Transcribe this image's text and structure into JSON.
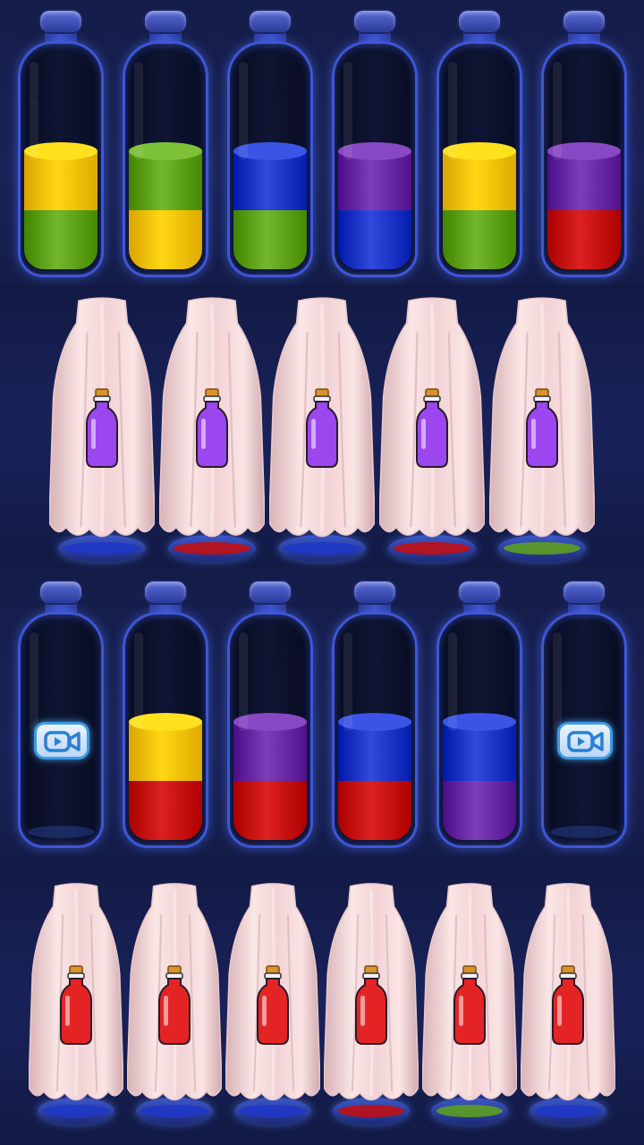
{
  "game": {
    "colors": {
      "yellow": "#f7c300",
      "green": "#5fa31a",
      "blue": "#1e36c8",
      "purple": "#6a2aa6",
      "red": "#c80d0d",
      "cloth": "#f4d6d6",
      "icon_purple": "#9b46ee",
      "icon_red": "#e42424",
      "glass_rim": "#3e56d8",
      "background": "#141c48"
    },
    "row1_bottles": [
      {
        "layers_bottom_to_top": [
          "green",
          "yellow"
        ]
      },
      {
        "layers_bottom_to_top": [
          "yellow",
          "green"
        ]
      },
      {
        "layers_bottom_to_top": [
          "green",
          "blue"
        ]
      },
      {
        "layers_bottom_to_top": [
          "blue",
          "purple"
        ]
      },
      {
        "layers_bottom_to_top": [
          "green",
          "yellow"
        ]
      },
      {
        "layers_bottom_to_top": [
          "red",
          "purple"
        ]
      }
    ],
    "row2_veiled": [
      {
        "hint_icon": "purple-potion-icon",
        "peek_color": "blue"
      },
      {
        "hint_icon": "purple-potion-icon",
        "peek_color": "red"
      },
      {
        "hint_icon": "purple-potion-icon",
        "peek_color": "blue"
      },
      {
        "hint_icon": "purple-potion-icon",
        "peek_color": "red"
      },
      {
        "hint_icon": "purple-potion-icon",
        "peek_color": "green"
      }
    ],
    "row3_bottles": [
      {
        "layers_bottom_to_top": [],
        "locked": true,
        "unlock_icon": "video-ad-icon"
      },
      {
        "layers_bottom_to_top": [
          "red",
          "yellow"
        ]
      },
      {
        "layers_bottom_to_top": [
          "red",
          "purple"
        ]
      },
      {
        "layers_bottom_to_top": [
          "red",
          "blue"
        ]
      },
      {
        "layers_bottom_to_top": [
          "purple",
          "blue"
        ]
      },
      {
        "layers_bottom_to_top": [],
        "locked": true,
        "unlock_icon": "video-ad-icon"
      }
    ],
    "row4_veiled": [
      {
        "hint_icon": "red-potion-icon",
        "peek_color": "blue"
      },
      {
        "hint_icon": "red-potion-icon",
        "peek_color": "blue"
      },
      {
        "hint_icon": "red-potion-icon",
        "peek_color": "blue"
      },
      {
        "hint_icon": "red-potion-icon",
        "peek_color": "red"
      },
      {
        "hint_icon": "red-potion-icon",
        "peek_color": "green"
      },
      {
        "hint_icon": "red-potion-icon",
        "peek_color": "blue"
      }
    ]
  }
}
